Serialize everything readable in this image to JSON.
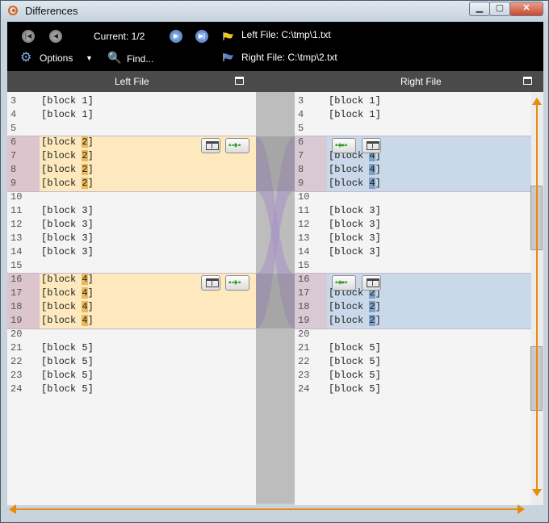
{
  "window": {
    "title": "Differences",
    "min_symbol": "▁",
    "max_symbol": "▢",
    "close_symbol": "✕"
  },
  "toolbar": {
    "current_label": "Current: 1/2",
    "options_label": "Options",
    "find_label": "Find...",
    "left_file_label": "Left File: C:\\tmp\\1.txt",
    "right_file_label": "Right File: C:\\tmp\\2.txt",
    "icons": {
      "first": "first-diff-icon",
      "prev": "previous-diff-icon",
      "next": "next-diff-icon",
      "last": "last-diff-icon",
      "options": "gear-icon",
      "find": "search-icon",
      "left_flag": "yellow-flag-icon",
      "right_flag": "blue-flag-icon"
    },
    "colors": {
      "left_flag": "#f0c419",
      "right_flag": "#5b7fc3"
    }
  },
  "headers": {
    "left_title": "Left File",
    "right_title": "Right File"
  },
  "left_pane": {
    "lines": [
      {
        "n": "3",
        "text": "[block 1]"
      },
      {
        "n": "4",
        "text": "[block 1]"
      },
      {
        "n": "5",
        "text": ""
      },
      {
        "n": "6",
        "pre": "[block ",
        "hl": "2",
        "post": "]"
      },
      {
        "n": "7",
        "pre": "[block ",
        "hl": "2",
        "post": "]"
      },
      {
        "n": "8",
        "pre": "[block ",
        "hl": "2",
        "post": "]"
      },
      {
        "n": "9",
        "pre": "[block ",
        "hl": "2",
        "post": "]"
      },
      {
        "n": "10",
        "text": ""
      },
      {
        "n": "11",
        "text": "[block 3]"
      },
      {
        "n": "12",
        "text": "[block 3]"
      },
      {
        "n": "13",
        "text": "[block 3]"
      },
      {
        "n": "14",
        "text": "[block 3]"
      },
      {
        "n": "15",
        "text": ""
      },
      {
        "n": "16",
        "pre": "[block ",
        "hl": "4",
        "post": "]"
      },
      {
        "n": "17",
        "pre": "[block ",
        "hl": "4",
        "post": "]"
      },
      {
        "n": "18",
        "pre": "[block ",
        "hl": "4",
        "post": "]"
      },
      {
        "n": "19",
        "pre": "[block ",
        "hl": "4",
        "post": "]"
      },
      {
        "n": "20",
        "text": ""
      },
      {
        "n": "21",
        "text": "[block 5]"
      },
      {
        "n": "22",
        "text": "[block 5]"
      },
      {
        "n": "23",
        "text": "[block 5]"
      },
      {
        "n": "24",
        "text": "[block 5]"
      }
    ]
  },
  "right_pane": {
    "lines": [
      {
        "n": "3",
        "text": "[block 1]"
      },
      {
        "n": "4",
        "text": "[block 1]"
      },
      {
        "n": "5",
        "text": ""
      },
      {
        "n": "6",
        "text": ""
      },
      {
        "n": "7",
        "pre": "[block ",
        "hl": "4",
        "post": "]"
      },
      {
        "n": "8",
        "pre": "[block ",
        "hl": "4",
        "post": "]"
      },
      {
        "n": "9",
        "pre": "[block ",
        "hl": "4",
        "post": "]"
      },
      {
        "n": "10",
        "text": ""
      },
      {
        "n": "11",
        "text": "[block 3]"
      },
      {
        "n": "12",
        "text": "[block 3]"
      },
      {
        "n": "13",
        "text": "[block 3]"
      },
      {
        "n": "14",
        "text": "[block 3]"
      },
      {
        "n": "15",
        "text": ""
      },
      {
        "n": "16",
        "text": ""
      },
      {
        "n": "17",
        "pre": "[block ",
        "hl": "2",
        "post": "]"
      },
      {
        "n": "18",
        "pre": "[block ",
        "hl": "2",
        "post": "]"
      },
      {
        "n": "19",
        "pre": "[block ",
        "hl": "2",
        "post": "]"
      },
      {
        "n": "20",
        "text": ""
      },
      {
        "n": "21",
        "text": "[block 5]"
      },
      {
        "n": "22",
        "text": "[block 5]"
      },
      {
        "n": "23",
        "text": "[block 5]"
      },
      {
        "n": "24",
        "text": "[block 5]"
      }
    ]
  },
  "colors": {
    "left_change": "#fde9bd",
    "right_change": "#cad9e9",
    "highlight_left": "#e8ba5c",
    "highlight_right": "#7fa1c8",
    "connector": "#bdbdbd",
    "connector_band": "#a58fc6",
    "accent_arrow": "#e88b0e"
  }
}
